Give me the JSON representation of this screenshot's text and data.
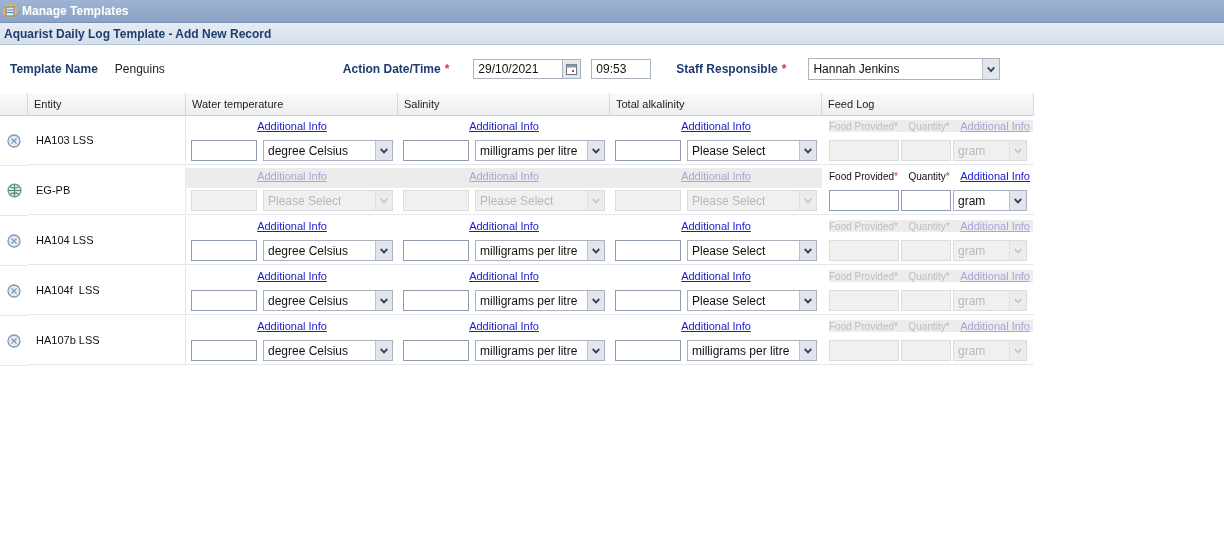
{
  "window": {
    "title": "Manage Templates"
  },
  "subtitle": "Aquarist Daily Log Template - Add New Record",
  "form": {
    "template_label": "Template Name",
    "template_value": "Penguins",
    "date_label": "Action Date/Time",
    "date_required": "*",
    "date_value": "29/10/2021",
    "time_value": "09:53",
    "staff_label": "Staff Responsible",
    "staff_required": "*",
    "staff_value": "Hannah Jenkins"
  },
  "table": {
    "columns": [
      "Entity",
      "Water temperature",
      "Salinity",
      "Total alkalinity",
      "Feed Log"
    ],
    "rows": [
      {
        "entity": "HA103 LSS",
        "kind": "tank",
        "measurements": [
          {
            "link": "Additional Info",
            "unit": "degree Celsius",
            "disabled": false
          },
          {
            "link": "Additional Info",
            "unit": "milligrams per litre",
            "disabled": false
          },
          {
            "link": "Additional Info",
            "unit": "Please Select",
            "disabled": false
          }
        ],
        "feed": {
          "food_label": "Food Provided",
          "food_required": "*",
          "quantity_label": "Quantity",
          "quantity_required": "*",
          "link": "Additional Info",
          "unit": "gram",
          "disabled": true
        }
      },
      {
        "entity": "EG-PB",
        "kind": "globe",
        "measurements": [
          {
            "link": "Additional Info",
            "unit": "Please Select",
            "disabled": true
          },
          {
            "link": "Additional Info",
            "unit": "Please Select",
            "disabled": true
          },
          {
            "link": "Additional Info",
            "unit": "Please Select",
            "disabled": true
          }
        ],
        "feed": {
          "food_label": "Food Provided",
          "food_required": "*",
          "quantity_label": "Quantity",
          "quantity_required": "*",
          "link": "Additional Info",
          "unit": "gram",
          "disabled": false
        }
      },
      {
        "entity": "HA104 LSS",
        "kind": "tank",
        "measurements": [
          {
            "link": "Additional Info",
            "unit": "degree Celsius",
            "disabled": false
          },
          {
            "link": "Additional Info",
            "unit": "milligrams per litre",
            "disabled": false
          },
          {
            "link": "Additional Info",
            "unit": "Please Select",
            "disabled": false
          }
        ],
        "feed": {
          "food_label": "Food Provided",
          "food_required": "*",
          "quantity_label": "Quantity",
          "quantity_required": "*",
          "link": "Additional Info",
          "unit": "gram",
          "disabled": true
        }
      },
      {
        "entity": "HA104f  LSS",
        "kind": "tank",
        "measurements": [
          {
            "link": "Additional Info",
            "unit": "degree Celsius",
            "disabled": false
          },
          {
            "link": "Additional Info",
            "unit": "milligrams per litre",
            "disabled": false
          },
          {
            "link": "Additional Info",
            "unit": "Please Select",
            "disabled": false
          }
        ],
        "feed": {
          "food_label": "Food Provided",
          "food_required": "*",
          "quantity_label": "Quantity",
          "quantity_required": "*",
          "link": "Additional Info",
          "unit": "gram",
          "disabled": true
        }
      },
      {
        "entity": "HA107b LSS",
        "kind": "tank",
        "measurements": [
          {
            "link": "Additional Info",
            "unit": "degree Celsius",
            "disabled": false
          },
          {
            "link": "Additional Info",
            "unit": "milligrams per litre",
            "disabled": false
          },
          {
            "link": "Additional Info",
            "unit": "milligrams per litre",
            "disabled": false
          }
        ],
        "feed": {
          "food_label": "Food Provided",
          "food_required": "*",
          "quantity_label": "Quantity",
          "quantity_required": "*",
          "link": "Additional Info",
          "unit": "gram",
          "disabled": true
        }
      }
    ]
  }
}
